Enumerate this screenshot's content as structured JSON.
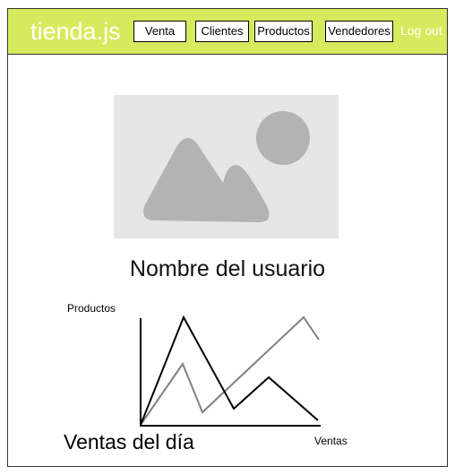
{
  "navbar": {
    "brand": "tienda.js",
    "buttons": [
      "Venta",
      "Clientes",
      "Productos",
      "Vendedores"
    ],
    "logout": "Log out",
    "color": "#d7ea5d"
  },
  "profile": {
    "image_icon": "image-placeholder-icon",
    "username": "Nombre del usuario"
  },
  "chart": {
    "title": "Ventas del día",
    "ylabel": "Productos",
    "xlabel": "Ventas"
  }
}
